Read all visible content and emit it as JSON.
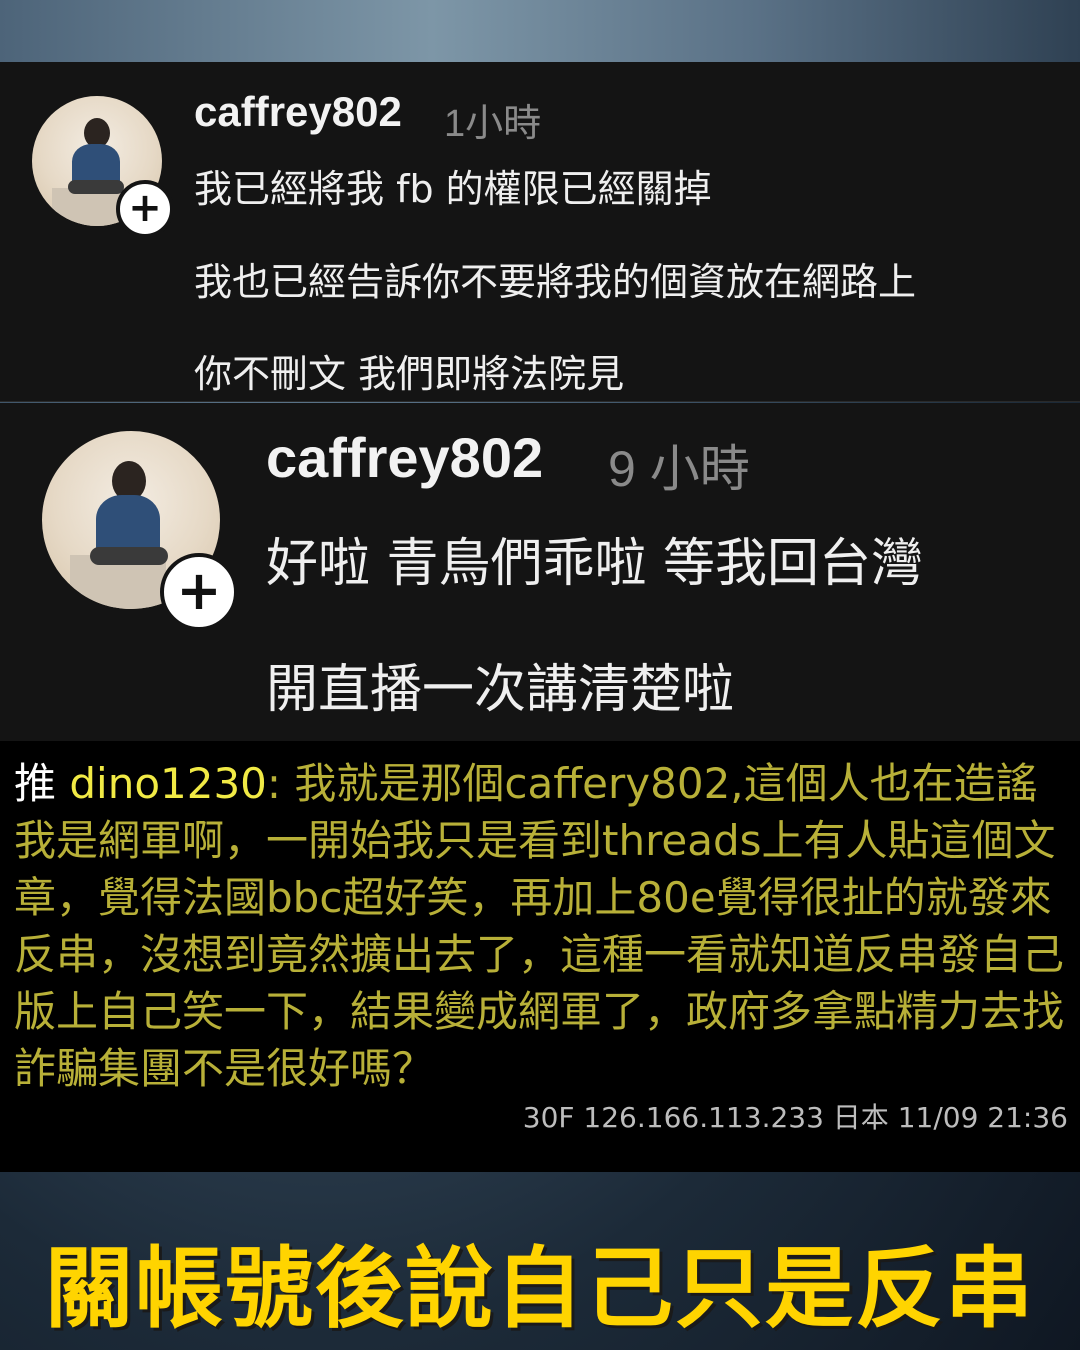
{
  "comment1": {
    "username": "caffrey802",
    "time": "1小時",
    "lines": [
      "我已經將我 fb 的權限已經關掉",
      "我也已經告訴你不要將我的個資放在網路上",
      "你不刪文 我們即將法院見"
    ],
    "follow_symbol": "+"
  },
  "comment2": {
    "username": "caffrey802",
    "time": "9 小時",
    "lines": [
      "好啦 青鳥們乖啦 等我回台灣",
      "開直播一次講清楚啦"
    ],
    "follow_symbol": "+"
  },
  "ptt_push": {
    "tag": "推",
    "user": "dino1230",
    "text": ": 我就是那個caffery802,這個人也在造謠我是網軍啊，一開始我只是看到threads上有人貼這個文章，覺得法國bbc超好笑，再加上80e覺得很扯的就發來反串，沒想到竟然擴出去了，這種一看就知道反串發自己版上自己笑一下，結果變成網軍了，政府多拿點精力去找詐騙集團不是很好嗎？",
    "meta": "30F 126.166.113.233 日本 11/09 21:36"
  },
  "caption": "關帳號後說自己只是反串",
  "colors": {
    "caption": "#ffd400",
    "ptt_user": "#f1ea45",
    "ptt_text": "#b8b038",
    "panel_bg": "#141414"
  }
}
